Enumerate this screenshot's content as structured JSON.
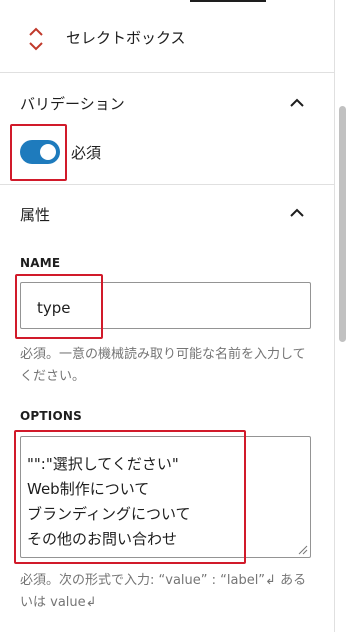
{
  "block": {
    "title": "セレクトボックス",
    "icon": "chevron-up-down-icon"
  },
  "validation": {
    "title": "バリデーション",
    "required_label": "必須",
    "required_on": true
  },
  "attributes": {
    "title": "属性",
    "name": {
      "label": "NAME",
      "value": "type",
      "help": "必須。一意の機械読み取り可能な名前を入力してください。"
    },
    "options": {
      "label": "OPTIONS",
      "lines": [
        "\"\":\"選択してください\"",
        "Web制作について",
        "ブランディングについて",
        "その他のお問い合わせ"
      ],
      "help": "必須。次の形式で入力: “value” : “label”↲ あるいは value↲"
    }
  },
  "colors": {
    "accent": "#1e7bbd",
    "highlight": "#d11a2a",
    "help_text": "#757575"
  }
}
